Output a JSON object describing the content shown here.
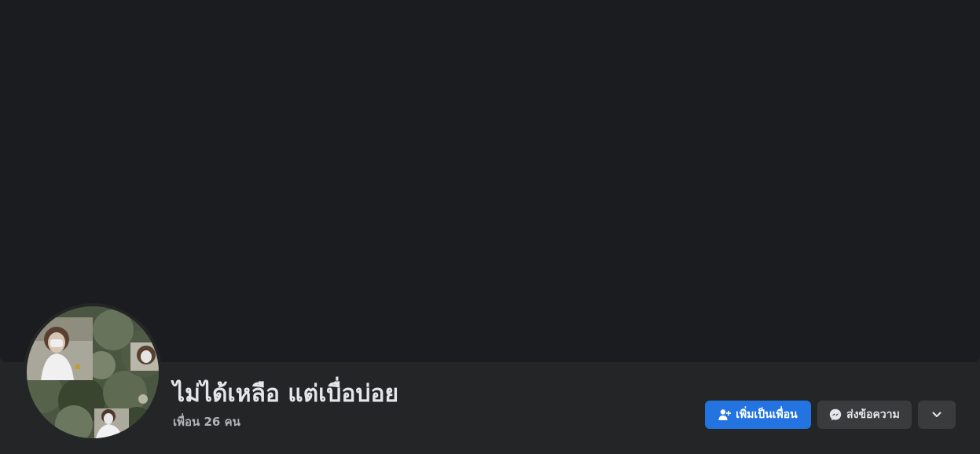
{
  "profile": {
    "name": "ไม่ได้เหลือ แต่เบื่อบ่อย",
    "friends_text": "เพื่อน 26 คน"
  },
  "actions": {
    "add_friend_label": "เพิ่มเป็นเพื่อน",
    "message_label": "ส่งข้อความ",
    "add_friend_icon": "person-add-icon",
    "message_icon": "messenger-icon",
    "more_icon": "chevron-down-icon"
  },
  "colors": {
    "page_bg": "#242526",
    "cover_bg": "#1b1c1f",
    "primary_button": "#2374e1",
    "secondary_button": "#3a3b3c",
    "primary_text": "#e4e6eb",
    "secondary_text": "#b0b3b8"
  }
}
